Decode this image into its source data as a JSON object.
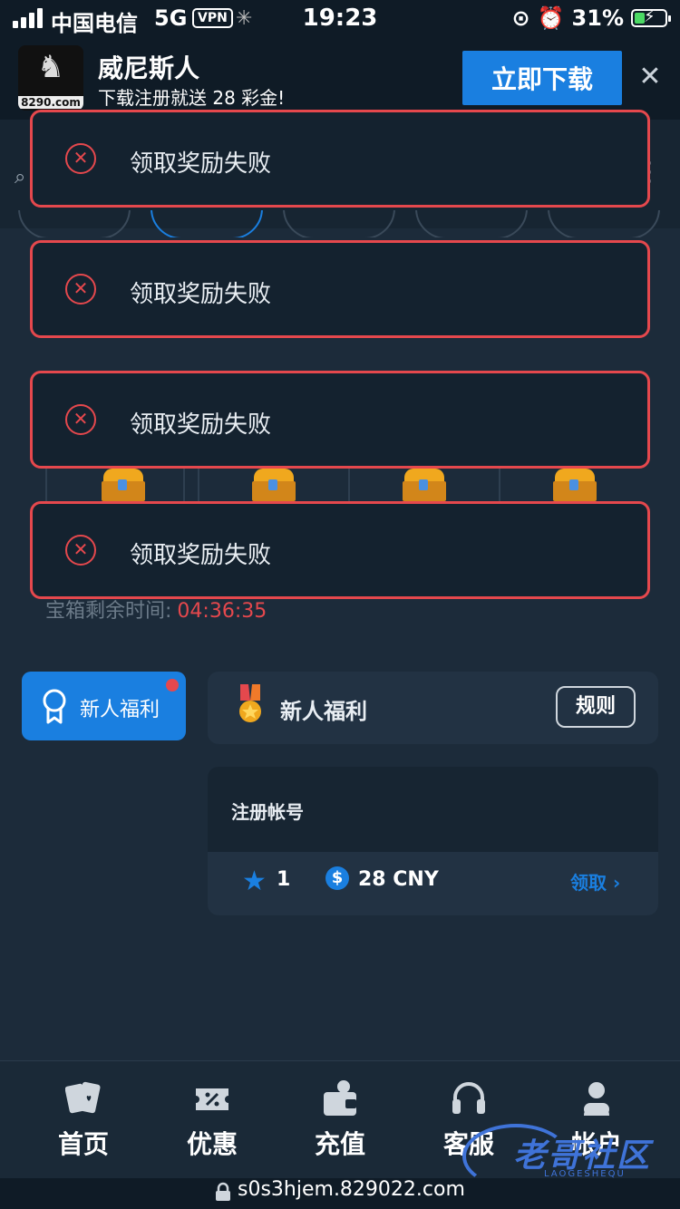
{
  "status_bar": {
    "carrier": "中国电信",
    "network": "5G",
    "vpn": "VPN",
    "time": "19:23",
    "battery": "31%"
  },
  "promo": {
    "app_name": "威尼斯人",
    "subtitle": "下载注册就送 28 彩金!",
    "logo_domain": "8290.com",
    "download_label": "立即下载"
  },
  "toasts": [
    {
      "message": "领取奖励失败"
    },
    {
      "message": "领取奖励失败"
    },
    {
      "message": "领取奖励失败"
    },
    {
      "message": "领取奖励失败"
    }
  ],
  "chest": {
    "timer_label": "宝箱剩余时间:",
    "timer_value": "04:36:35"
  },
  "side_tab": {
    "label": "新人福利"
  },
  "benefit": {
    "title": "新人福利",
    "rules_label": "规则"
  },
  "task": {
    "title": "注册帐号",
    "points": "1",
    "amount": "28 CNY",
    "claim_label": "领取"
  },
  "tabbar": [
    {
      "label": "首页",
      "icon": "cards-icon"
    },
    {
      "label": "优惠",
      "icon": "coupon-icon"
    },
    {
      "label": "充值",
      "icon": "wallet-icon"
    },
    {
      "label": "客服",
      "icon": "headset-icon"
    },
    {
      "label": "帐户",
      "icon": "user-icon"
    }
  ],
  "watermark": {
    "text": "老哥社区",
    "sub": "LAOGESHEQU"
  },
  "url": "s0s3hjem.829022.com",
  "colors": {
    "accent": "#1a7fe0",
    "error": "#e5484d",
    "background": "#1c2b3a"
  }
}
